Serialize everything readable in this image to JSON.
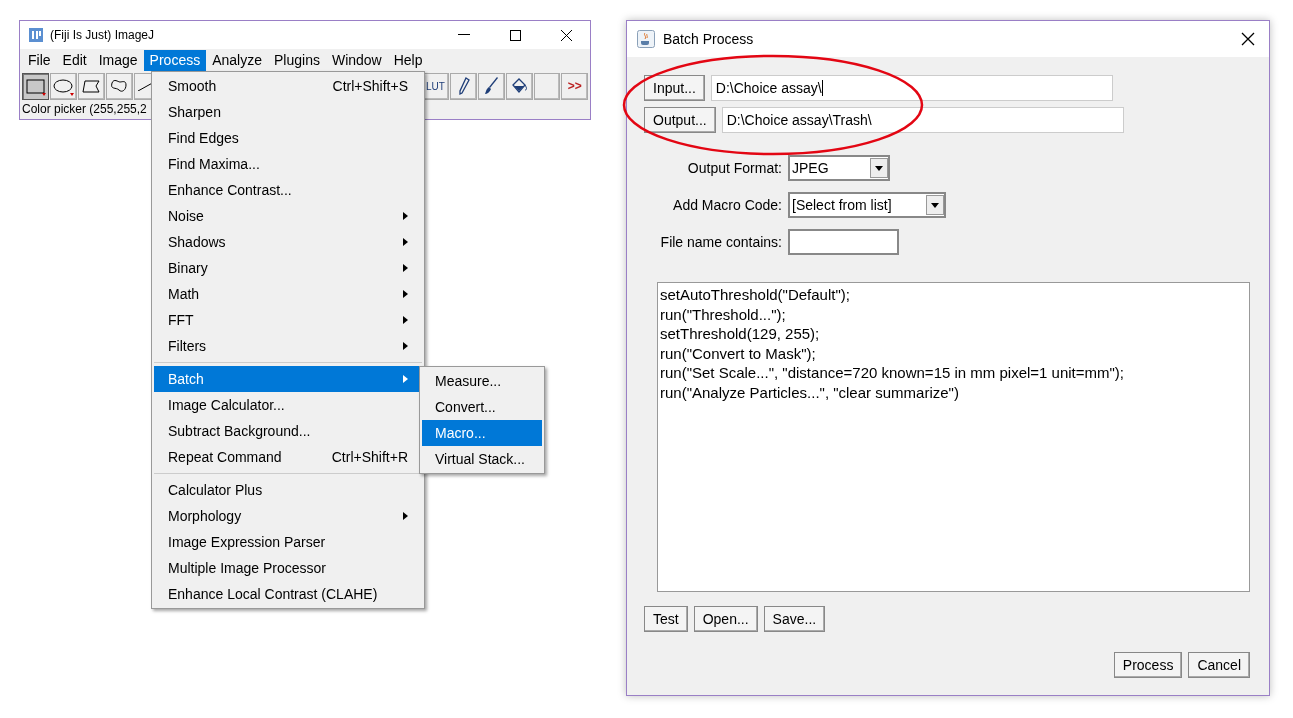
{
  "imagej_window": {
    "title": "(Fiji Is Just) ImageJ",
    "menu_bar": [
      {
        "label": "File",
        "selected": false
      },
      {
        "label": "Edit",
        "selected": false
      },
      {
        "label": "Image",
        "selected": false
      },
      {
        "label": "Process",
        "selected": true
      },
      {
        "label": "Analyze",
        "selected": false
      },
      {
        "label": "Plugins",
        "selected": false
      },
      {
        "label": "Window",
        "selected": false
      },
      {
        "label": "Help",
        "selected": false
      }
    ],
    "tools_left": [
      {
        "kind": "rectangle",
        "selected": true
      },
      {
        "kind": "oval",
        "selected": false
      },
      {
        "kind": "polygon",
        "selected": false
      },
      {
        "kind": "freehand",
        "selected": false
      },
      {
        "kind": "line",
        "selected": false
      }
    ],
    "tools_right": [
      {
        "kind": "lut",
        "label": "LUT",
        "selected": false
      },
      {
        "kind": "pencil",
        "selected": false
      },
      {
        "kind": "brush",
        "selected": false
      },
      {
        "kind": "fill",
        "selected": false
      },
      {
        "kind": "blank",
        "selected": false
      },
      {
        "kind": "more",
        "label": ">>",
        "selected": false
      }
    ],
    "status": "Color picker (255,255,2"
  },
  "process_menu": [
    {
      "kind": "item",
      "label": "Smooth",
      "shortcut": "Ctrl+Shift+S",
      "selected": false
    },
    {
      "kind": "item",
      "label": "Sharpen",
      "selected": false
    },
    {
      "kind": "item",
      "label": "Find Edges",
      "selected": false
    },
    {
      "kind": "item",
      "label": "Find Maxima...",
      "selected": false
    },
    {
      "kind": "item",
      "label": "Enhance Contrast...",
      "selected": false
    },
    {
      "kind": "submenu",
      "label": "Noise",
      "selected": false
    },
    {
      "kind": "submenu",
      "label": "Shadows",
      "selected": false
    },
    {
      "kind": "submenu",
      "label": "Binary",
      "selected": false
    },
    {
      "kind": "submenu",
      "label": "Math",
      "selected": false
    },
    {
      "kind": "submenu",
      "label": "FFT",
      "selected": false
    },
    {
      "kind": "submenu",
      "label": "Filters",
      "selected": false
    },
    {
      "kind": "separator"
    },
    {
      "kind": "submenu",
      "label": "Batch",
      "selected": true
    },
    {
      "kind": "item",
      "label": "Image Calculator...",
      "selected": false
    },
    {
      "kind": "item",
      "label": "Subtract Background...",
      "selected": false
    },
    {
      "kind": "item",
      "label": "Repeat Command",
      "shortcut": "Ctrl+Shift+R",
      "selected": false
    },
    {
      "kind": "separator"
    },
    {
      "kind": "item",
      "label": "Calculator Plus",
      "selected": false
    },
    {
      "kind": "submenu",
      "label": "Morphology",
      "selected": false
    },
    {
      "kind": "item",
      "label": "Image Expression Parser",
      "selected": false
    },
    {
      "kind": "item",
      "label": "Multiple Image Processor",
      "selected": false
    },
    {
      "kind": "item",
      "label": "Enhance Local Contrast (CLAHE)",
      "selected": false
    }
  ],
  "batch_submenu": [
    {
      "label": "Measure...",
      "selected": false
    },
    {
      "label": "Convert...",
      "selected": false
    },
    {
      "label": "Macro...",
      "selected": true
    },
    {
      "label": "Virtual Stack...",
      "selected": false
    }
  ],
  "batch_dialog": {
    "title": "Batch Process",
    "input": {
      "button": "Input...",
      "value": "D:\\Choice assay\\"
    },
    "output": {
      "button": "Output...",
      "value": "D:\\Choice assay\\Trash\\"
    },
    "output_format": {
      "label": "Output Format:",
      "value": "JPEG"
    },
    "macro_code_select": {
      "label": "Add Macro Code:",
      "value": "[Select from list]"
    },
    "file_name_contains": {
      "label": "File name contains:"
    },
    "code_lines": [
      "setAutoThreshold(\"Default\");",
      "run(\"Threshold...\");",
      "setThreshold(129, 255);",
      "run(\"Convert to Mask\");",
      "run(\"Set Scale...\", \"distance=720 known=15 in mm pixel=1 unit=mm\");",
      "run(\"Analyze Particles...\", \"clear summarize\")"
    ],
    "left_buttons": [
      "Test",
      "Open...",
      "Save..."
    ],
    "right_buttons": [
      "Process",
      "Cancel"
    ]
  }
}
